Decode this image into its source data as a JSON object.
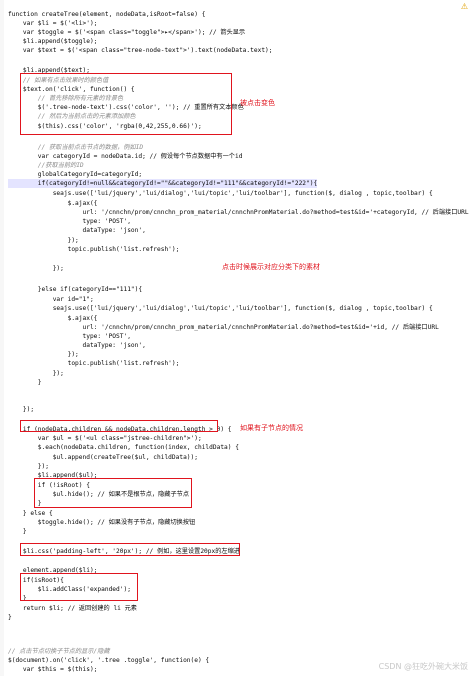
{
  "warning_icon": "warning-triangle-icon",
  "code": {
    "l1": "function createTree(element, nodeData,isRoot=false) {",
    "l2": "    var $li = $('<li>');",
    "l3": "    var $toggle = $('<span class=\"toggle\">▸</span>'); // 箭头显示",
    "l4": "    $li.append($toggle);",
    "l5": "    var $text = $('<span class=\"tree-node-text\">').text(nodeData.text);",
    "l6": "",
    "l7": "    $li.append($text);",
    "l8": "    // 如果有点击效果时的颜色值",
    "l9": "    $text.on('click', function() {",
    "l10": "        // 首先移除所有元素的背景色",
    "l11": "        $('.tree-node-text').css('color', ''); // 重置所有文本颜色",
    "l12": "        // 然后为当前点击的元素添加颜色",
    "l13": "        $(this).css('color', 'rgba(0,42,255,0.66)');",
    "l14": "",
    "l15": "        // 获取当前点击节点的数据，例如ID",
    "l16": "        var categoryId = nodeData.id; // 假设每个节点数据中有一个id",
    "l17": "        //获取当前的ID",
    "l18": "        globalCategoryId=categoryId;",
    "l19": "        if(categoryId!=null&&categoryId!=\"\"&&categoryId!=\"111\"&&categoryId!=\"222\"){",
    "l20": "            seajs.use(['lui/jquery','lui/dialog','lui/topic','lui/toolbar'], function($, dialog , topic,toolbar) {",
    "l21": "                $.ajax({",
    "l22": "                    url: '/cnnchn/prom/cnnchn_prom_material/cnnchnPromMaterial.do?method=test&id='+categoryId, // 后端接口URL",
    "l23": "                    type: 'POST',",
    "l24": "                    dataType: 'json',",
    "l25": "                });",
    "l26": "                topic.publish('list.refresh');",
    "l27": "",
    "l28": "            });",
    "l29": "",
    "l30": "",
    "l31": "        }else if(categoryId==\"111\"){",
    "l32": "            var id=\"1\";",
    "l33": "            seajs.use(['lui/jquery','lui/dialog','lui/topic','lui/toolbar'], function($, dialog , topic,toolbar) {",
    "l34": "                $.ajax({",
    "l35": "                    url: '/cnnchn/prom/cnnchn_prom_material/cnnchnPromMaterial.do?method=test&id='+id, // 后端接口URL",
    "l36": "                    type: 'POST',",
    "l37": "                    dataType: 'json',",
    "l38": "                });",
    "l39": "                topic.publish('list.refresh');",
    "l40": "            });",
    "l41": "        }",
    "l42": "",
    "l43": "",
    "l44": "    });",
    "l45": "",
    "l46": "    if (nodeData.children && nodeData.children.length > 0) {",
    "l47": "        var $ul = $('<ul class=\"jstree-children\">');",
    "l48": "        $.each(nodeData.children, function(index, childData) {",
    "l49": "            $ul.append(createTree($ul, childData));",
    "l50": "        });",
    "l51": "        $li.append($ul);",
    "l52": "        if (!isRoot) {",
    "l53": "            $ul.hide(); // 如果不是根节点，隐藏子节点",
    "l54": "        }",
    "l55": "    } else {",
    "l56": "        $toggle.hide(); // 如果没有子节点，隐藏切换按钮",
    "l57": "    }",
    "l58": "",
    "l59": "    $li.css('padding-left', '20px'); // 例如，这里设置20px的左缩进",
    "l60": "",
    "l61": "    element.append($li);",
    "l62": "    if(isRoot){",
    "l63": "        $li.addClass('expanded');",
    "l64": "    }",
    "l65": "    return $li; // 返回创建的 li 元素",
    "l66": "}",
    "l67": "",
    "l68": "",
    "l69": "",
    "l70": "// 点击节点切换子节点的显示/隐藏",
    "l71": "$(document).on('click', '.tree .toggle', function(e) {",
    "l72": "    var $this = $(this);"
  },
  "annotations": {
    "click_color": "被点击变色",
    "click_material": "点击时候展示对应分类下的素材",
    "has_children": "如果有子节点的情况"
  },
  "watermark": "CSDN @狂吃外碗大米饭"
}
